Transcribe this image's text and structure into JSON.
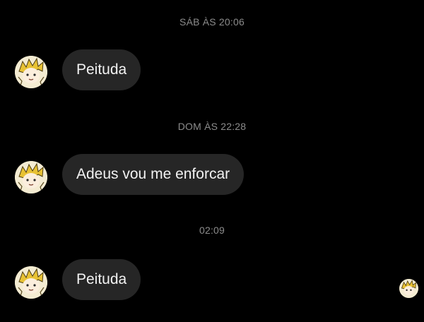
{
  "conversation": {
    "messages": [
      {
        "timestamp": "SÁB ÀS 20:06",
        "text": "Peituda"
      },
      {
        "timestamp": "DOM ÀS 22:28",
        "text": "Adeus vou me enforcar"
      },
      {
        "timestamp": "02:09",
        "text": "Peituda"
      }
    ]
  },
  "colors": {
    "background": "#000000",
    "bubble": "#262626",
    "bubble_text": "#f2f2f2",
    "timestamp": "#8c8c8c"
  },
  "icons": {
    "sender_avatar": "anime-character-avatar",
    "seen_indicator": "seen-avatar-icon"
  }
}
